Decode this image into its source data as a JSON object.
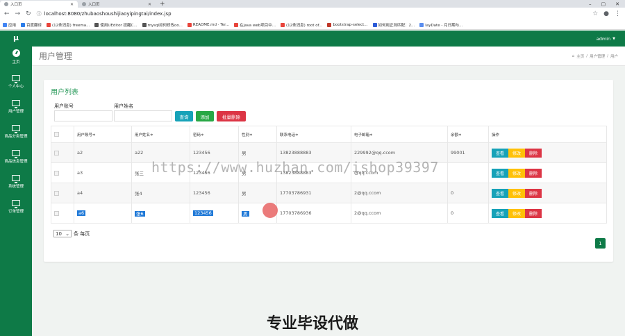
{
  "browser": {
    "tabs": [
      {
        "title": "入口页",
        "active": true
      },
      {
        "title": "入口页",
        "active": false
      }
    ],
    "new_tab": "+",
    "url": "localhost:8080/zhubaoshoushijiaoyipingtai/index.jsp",
    "bookmarks": [
      {
        "label": "应用",
        "color": "#4285f4"
      },
      {
        "label": "百度翻译",
        "color": "#2b7de9"
      },
      {
        "label": "(12条消息) freema...",
        "color": "#e8453c"
      },
      {
        "label": "使用UEditor 提醒C...",
        "color": "#555555"
      },
      {
        "label": "mysql如何修改oo...",
        "color": "#555555"
      },
      {
        "label": "README.md · Ter...",
        "color": "#e8453c"
      },
      {
        "label": "在java web项目中...",
        "color": "#e8453c"
      },
      {
        "label": "(12条消息) root of...",
        "color": "#e8453c"
      },
      {
        "label": "bootstrap-select...",
        "color": "#c0392b"
      },
      {
        "label": "如何用正则匹配：2...",
        "color": "#2b5bd7"
      },
      {
        "label": "layDate - 月日期与...",
        "color": "#5a8dee"
      }
    ]
  },
  "colors": {
    "primary": "#0e7a47",
    "accent_title": "#2e9c5e",
    "btn_search": "#17a2b8",
    "btn_add": "#28a745",
    "btn_delete": "#dc3545",
    "btn_edit": "#ffc107"
  },
  "app": {
    "logo": "μ",
    "user": "admin",
    "sidebar": [
      {
        "label": "主页",
        "icon": "dashboard-icon"
      },
      {
        "label": "个人中心",
        "icon": "monitor-icon"
      },
      {
        "label": "用户管理",
        "icon": "monitor-icon"
      },
      {
        "label": "商品分类管理",
        "icon": "monitor-icon"
      },
      {
        "label": "商品信息管理",
        "icon": "monitor-icon"
      },
      {
        "label": "系统管理",
        "icon": "monitor-icon"
      },
      {
        "label": "订单管理",
        "icon": "monitor-icon"
      }
    ],
    "page_title": "用户管理",
    "breadcrumb": [
      "主页",
      "用户管理",
      "用户"
    ],
    "card_title": "用户列表",
    "filters": {
      "account_label": "用户账号",
      "name_label": "用户姓名"
    },
    "buttons": {
      "search": "查询",
      "add": "添加",
      "batch_delete": "批量删除"
    },
    "table": {
      "headers": [
        "用户账号≑",
        "用户姓名≑",
        "密码≑",
        "性别≑",
        "联系电话≑",
        "电子邮箱≑",
        "余额≑",
        "操作"
      ],
      "rows": [
        {
          "account": "a2",
          "name": "a22",
          "password": "123456",
          "gender": "男",
          "phone": "13823888883",
          "email": "229992@qq.ccom",
          "balance": "99001"
        },
        {
          "account": "a3",
          "name": "张三",
          "password": "123456",
          "gender": "男",
          "phone": "13823888883",
          "email": "@qq.ccom",
          "balance": ""
        },
        {
          "account": "a4",
          "name": "张4",
          "password": "123456",
          "gender": "男",
          "phone": "17703786931",
          "email": "2@qq.ccom",
          "balance": "0"
        },
        {
          "account": "a6",
          "name": "张6",
          "password": "123456",
          "gender": "男",
          "phone": "17703786936",
          "email": "2@qq.ccom",
          "balance": "0"
        }
      ],
      "actions": {
        "view": "查看",
        "edit": "修改",
        "delete": "删除"
      }
    },
    "pager": {
      "page_size": "10",
      "page_size_suffix": "条 每页",
      "current_page": "1"
    }
  },
  "overlay": {
    "watermark": "https://www.huzhan.com/ishop39397",
    "caption": "专业毕设代做"
  }
}
